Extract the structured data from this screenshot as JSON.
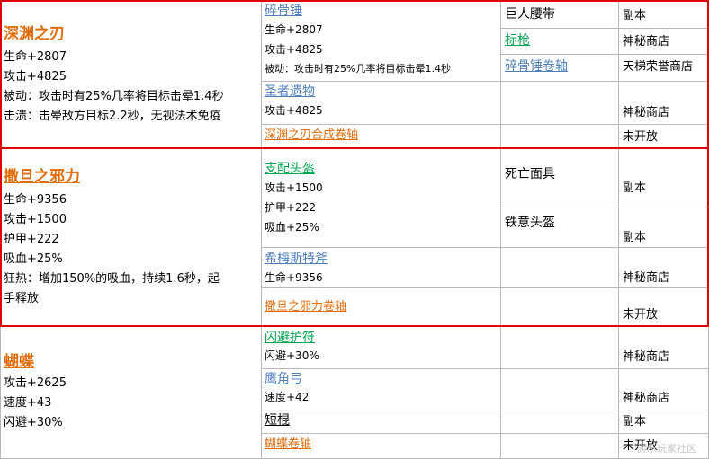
{
  "sections": [
    {
      "title": "深渊之刃",
      "stats": [
        "生命+2807",
        "攻击+4825",
        "被动：攻击时有25%几率将目标击晕1.4秒",
        "击溃：击晕敌方目标2.2秒，无视法术免疫"
      ],
      "components": [
        {
          "name": "碎骨锤",
          "stats": [
            "生命+2807",
            "攻击+4825",
            "被动：攻击时有25%几率将目标击晕1.4秒"
          ]
        },
        {
          "name": "圣者遗物",
          "stats": [
            "攻击+4825"
          ]
        },
        {
          "name": "深渊之刃合成卷轴",
          "stats": []
        }
      ],
      "subparts": [
        {
          "name": "巨人腰带",
          "source": "副本"
        },
        {
          "name": "标枪",
          "source": "神秘商店"
        },
        {
          "name": "碎骨锤卷轴",
          "source": "天梯荣誉商店"
        }
      ],
      "relic_source": "神秘商店",
      "scroll_source": "未开放"
    },
    {
      "title": "撒旦之邪力",
      "stats": [
        "生命+9356",
        "攻击+1500",
        "护甲+222",
        "吸血+25%",
        "狂热：增加150%的吸血，持续1.6秒，起",
        "手释放"
      ],
      "components": [
        {
          "name": "支配头盔",
          "stats": [
            "攻击+1500",
            "护甲+222",
            "吸血+25%"
          ]
        },
        {
          "name": "希梅斯特斧",
          "stats": [
            "生命+9356"
          ]
        },
        {
          "name": "撒旦之邪力卷轴",
          "stats": []
        }
      ],
      "subparts": [
        {
          "name": "死亡面具",
          "source": "副本"
        },
        {
          "name": "铁意头盔",
          "source": "副本"
        }
      ],
      "axe_source": "神秘商店",
      "scroll_source": "未开放"
    },
    {
      "title": "蝴蝶",
      "stats": [
        "攻击+2625",
        "速度+43",
        "闪避+30%"
      ],
      "components": [
        {
          "name": "闪避护符",
          "stats": [
            "闪避+30%"
          ],
          "source": "神秘商店"
        },
        {
          "name": "鹰角弓",
          "stats": [
            "速度+42"
          ],
          "source": "神秘商店"
        },
        {
          "name": "短棍",
          "stats": [],
          "source": "副本"
        },
        {
          "name": "蝴蝶卷轴",
          "stats": [],
          "source": "未开放"
        }
      ]
    }
  ],
  "watermark": "游乐玩家社区"
}
